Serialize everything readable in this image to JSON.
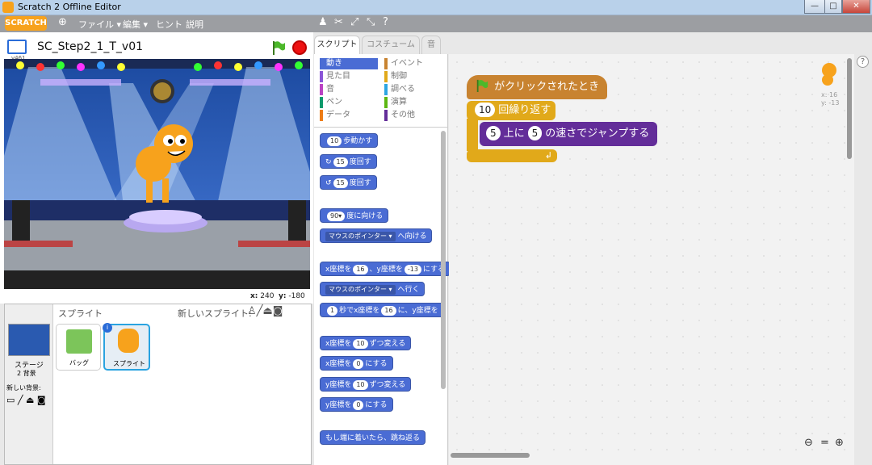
{
  "window": {
    "title": "Scratch 2 Offline Editor"
  },
  "menubar": {
    "logo": "SCRATCH",
    "file": "ファイル ▾",
    "edit": "編集 ▾",
    "hint": "ヒント",
    "about": "説明"
  },
  "stage": {
    "project_title": "SC_Step2_1_T_v01",
    "version": "v461",
    "x_label": "x:",
    "x_value": "240",
    "y_label": "y:",
    "y_value": "-180"
  },
  "sprites": {
    "header": "スプライト",
    "new_sprite": "新しいスプライト:",
    "stage_label": "ステージ",
    "backdrops": "2 背景",
    "new_backdrop": "新しい背景:",
    "items": [
      "バッグ",
      "スプライト"
    ]
  },
  "tabs": [
    "スクリプト",
    "コスチューム",
    "音"
  ],
  "categories": [
    {
      "label": "動き",
      "color": "#4a6cd4",
      "active": true
    },
    {
      "label": "イベント",
      "color": "#c88330"
    },
    {
      "label": "見た目",
      "color": "#8a55d7"
    },
    {
      "label": "制御",
      "color": "#e1a91a"
    },
    {
      "label": "音",
      "color": "#bb42c3"
    },
    {
      "label": "調べる",
      "color": "#2ca5e2"
    },
    {
      "label": "ペン",
      "color": "#0e9a6c"
    },
    {
      "label": "演算",
      "color": "#5cb712"
    },
    {
      "label": "データ",
      "color": "#ee7d16"
    },
    {
      "label": "その他",
      "color": "#632d99"
    }
  ],
  "palette": {
    "move": {
      "num": "10",
      "text": "歩動かす"
    },
    "turn_right": {
      "num": "15",
      "text": "度回す"
    },
    "turn_left": {
      "num": "15",
      "text": "度回す"
    },
    "point_dir": {
      "num": "90▾",
      "text": "度に向ける"
    },
    "point_towards": {
      "drop": "マウスのポインター ▾",
      "text": "へ向ける"
    },
    "goto_xy": {
      "a": "x座標を",
      "x": "16",
      "b": "、y座標を",
      "y": "-13",
      "c": "にする"
    },
    "goto": {
      "drop": "マウスのポインター ▾",
      "text": "へ行く"
    },
    "glide": {
      "secs": "1",
      "a": "秒でx座標を",
      "x": "16",
      "b": "に、y座標を"
    },
    "change_x": {
      "a": "x座標を",
      "num": "10",
      "b": "ずつ変える"
    },
    "set_x": {
      "a": "x座標を",
      "num": "0",
      "b": "にする"
    },
    "change_y": {
      "a": "y座標を",
      "num": "10",
      "b": "ずつ変える"
    },
    "set_y": {
      "a": "y座標を",
      "num": "0",
      "b": "にする"
    },
    "bounce": {
      "text": "もし端に着いたら、跳ね返る"
    }
  },
  "script": {
    "hat": "がクリックされたとき",
    "repeat_count": "10",
    "repeat_text": "回繰り返す",
    "jump_a": "5",
    "jump_text1": "上に",
    "jump_b": "5",
    "jump_text2": "の速さでジャンプする"
  },
  "sprite_info": {
    "x": "x: 16",
    "y": "y: -13"
  }
}
